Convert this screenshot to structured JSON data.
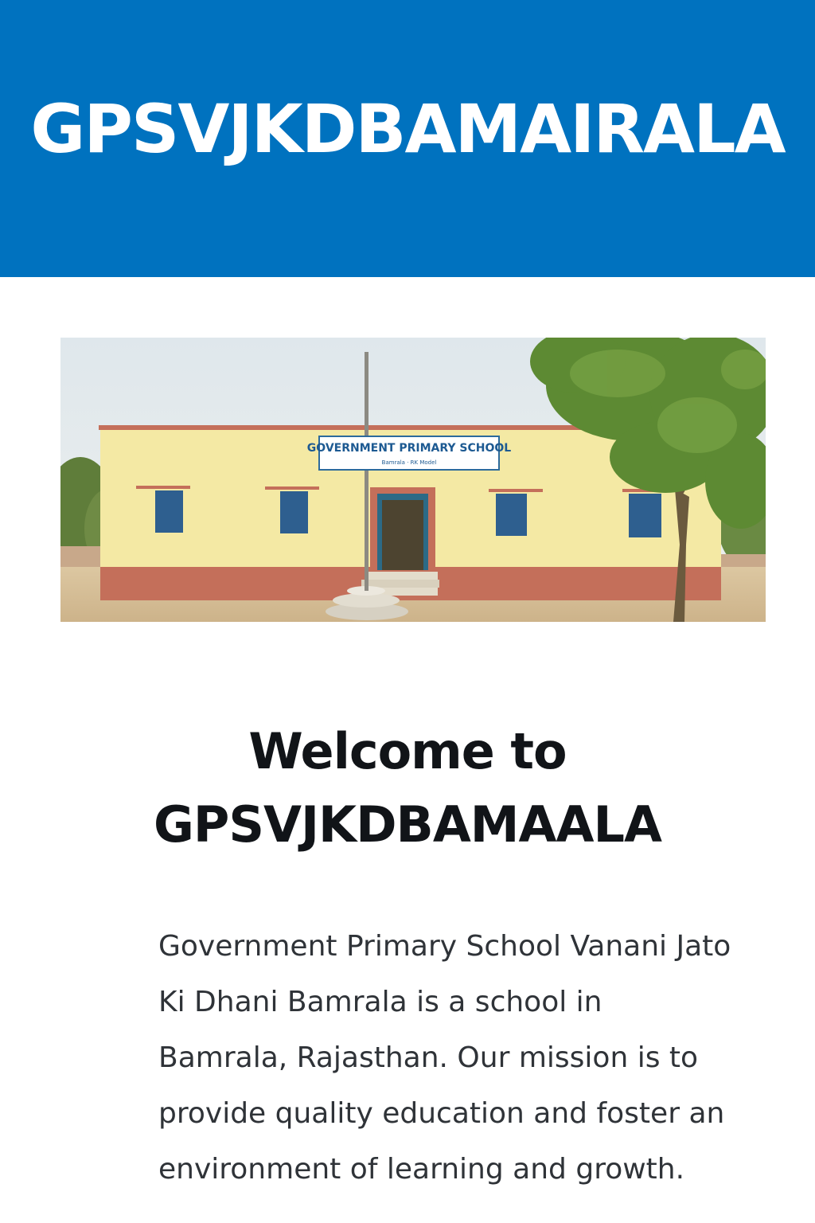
{
  "header": {
    "site_title": "GPSVJKDBAMAIRALA",
    "background_color": "#0072bf"
  },
  "hero": {
    "sign_line1": "GOVERNMENT PRIMARY SCHOOL",
    "sign_line2": "Bamrala · RK Model"
  },
  "main": {
    "welcome_line1": "Welcome to",
    "welcome_line2": "GPSVJKDBAMAALA",
    "intro_text": "Government Primary  School Vanani Jato Ki Dhani Bamrala is a school in Bamrala, Rajasthan. Our mission is to provide quality education and foster an environment of learning and growth."
  }
}
